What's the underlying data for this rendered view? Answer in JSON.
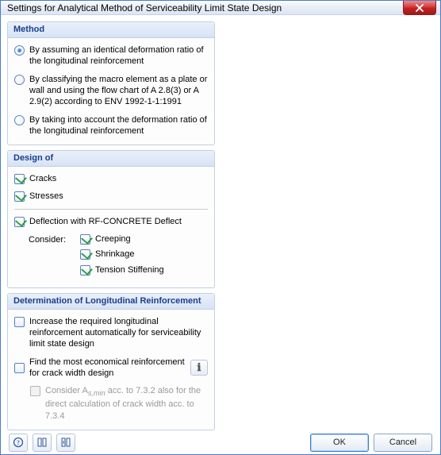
{
  "window": {
    "title": "Settings for Analytical Method of Serviceability Limit State Design"
  },
  "method": {
    "header": "Method",
    "opt1": "By assuming an identical deformation ratio of the longitudinal reinforcement",
    "opt2": "By classifying the macro element as a plate or wall and using the flow chart of A 2.8(3) or A 2.9(2) according to ENV 1992-1-1:1991",
    "opt3": "By taking into account the deformation ratio of the longitudinal reinforcement"
  },
  "design": {
    "header": "Design of",
    "cracks": "Cracks",
    "stresses": "Stresses",
    "deflection": "Deflection with RF-CONCRETE Deflect",
    "consider": "Consider:",
    "creeping": "Creeping",
    "shrinkage": "Shrinkage",
    "tension": "Tension Stiffening"
  },
  "reinf": {
    "header": "Determination of Longitudinal Reinforcement",
    "increase": "Increase the required longitudinal reinforcement automatically for serviceability limit state design",
    "economical": "Find the most economical reinforcement for crack width design",
    "consider_asmin_pre": "Consider A",
    "consider_asmin_sub": "s,min",
    "consider_asmin_post": " acc. to 7.3.2 also for the direct calculation of crack width acc. to 7.3.4"
  },
  "buttons": {
    "ok": "OK",
    "cancel": "Cancel"
  }
}
